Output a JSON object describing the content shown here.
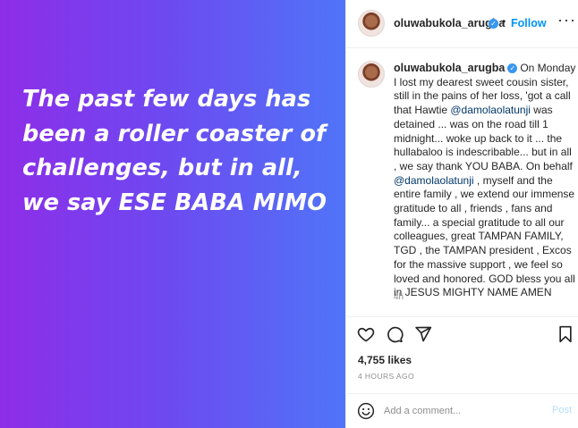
{
  "post": {
    "quote": "The past few days has been a roller coaster of challenges, but in all, we say ESE BABA MIMO"
  },
  "header": {
    "username": "oluwabukola_arugba",
    "verified_glyph": "✓",
    "dot": "•",
    "follow_label": "Follow",
    "more_glyph": "···"
  },
  "caption": {
    "username": "oluwabukola_arugba",
    "part1": "On Monday I lost my dearest sweet cousin sister, still in the pains of her loss, 'got a call that Hawtie ",
    "mention1": "@damolaolatunji",
    "part2": " was detained ... was on the road till 1 midnight... woke up back to it ... the hullabaloo is indescribable... but in all , we say thank YOU BABA. On behalf ",
    "mention2": "@damolaolatunji",
    "part3": " , myself and the entire family , we extend our immense gratitude to all , friends , fans and family... a special gratitude to all our colleagues, great TAMPAN FAMILY, TGD , the TAMPAN president , Excos for the massive support , we feel so loved and honored. GOD bless you all in JESUS MIGHTY NAME AMEN",
    "time": "4h"
  },
  "actions": {
    "icons": [
      "heart-icon",
      "comment-icon",
      "share-icon",
      "bookmark-icon"
    ]
  },
  "stats": {
    "likes": "4,755 likes",
    "posted_ago": "4 HOURS AGO"
  },
  "comment": {
    "placeholder": "Add a comment...",
    "post_label": "Post",
    "emoji_icon": "smiley-icon"
  },
  "colors": {
    "gradient_start": "#8e2de8",
    "gradient_end": "#4f75f8",
    "follow": "#0095f6",
    "mention": "#00376b",
    "verified": "#3897f0"
  }
}
